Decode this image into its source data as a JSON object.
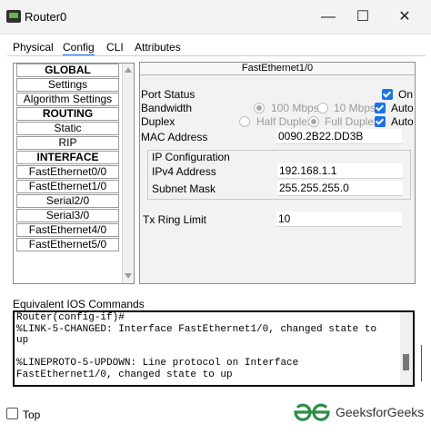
{
  "window": {
    "title": "Router0",
    "minimize_glyph": "—",
    "maximize_glyph": "☐",
    "close_glyph": "✕"
  },
  "tabs": [
    {
      "label": "Physical",
      "active": false
    },
    {
      "label": "Config",
      "active": true
    },
    {
      "label": "CLI",
      "active": false
    },
    {
      "label": "Attributes",
      "active": false
    }
  ],
  "sidebar": {
    "items": [
      {
        "label": "GLOBAL",
        "header": true
      },
      {
        "label": "Settings",
        "header": false
      },
      {
        "label": "Algorithm Settings",
        "header": false
      },
      {
        "label": "ROUTING",
        "header": true
      },
      {
        "label": "Static",
        "header": false
      },
      {
        "label": "RIP",
        "header": false
      },
      {
        "label": "INTERFACE",
        "header": true
      },
      {
        "label": "FastEthernet0/0",
        "header": false
      },
      {
        "label": "FastEthernet1/0",
        "header": false
      },
      {
        "label": "Serial2/0",
        "header": false
      },
      {
        "label": "Serial3/0",
        "header": false
      },
      {
        "label": "FastEthernet4/0",
        "header": false
      },
      {
        "label": "FastEthernet5/0",
        "header": false
      }
    ]
  },
  "interface": {
    "title": "FastEthernet1/0",
    "port_status_label": "Port Status",
    "port_on_label": "On",
    "port_on": true,
    "bandwidth_label": "Bandwidth",
    "bw_100": "100 Mbps",
    "bw_10": "10 Mbps",
    "bw_auto": "Auto",
    "bw_auto_checked": true,
    "duplex_label": "Duplex",
    "half_duplex": "Half Duplex",
    "full_duplex": "Full Duplex",
    "duplex_auto": "Auto",
    "duplex_auto_checked": true,
    "mac_label": "MAC Address",
    "mac_value": "0090.2B22.DD3B",
    "ip_config_label": "IP Configuration",
    "ipv4_label": "IPv4 Address",
    "ipv4_value": "192.168.1.1",
    "subnet_label": "Subnet Mask",
    "subnet_value": "255.255.255.0",
    "tx_ring_label": "Tx Ring Limit",
    "tx_ring_value": "10"
  },
  "ios": {
    "label": "Equivalent IOS Commands",
    "lines": "Router(config-if)#\n%LINK-5-CHANGED: Interface FastEthernet1/0, changed state to\nup\n\n%LINEPROTO-5-UPDOWN: Line protocol on Interface\nFastEthernet1/0, changed state to up"
  },
  "footer": {
    "top_label": "Top",
    "top_checked": false,
    "brand": "GeeksforGeeks"
  },
  "colors": {
    "accent": "#1a73e8",
    "brand_green": "#2f8d46"
  }
}
